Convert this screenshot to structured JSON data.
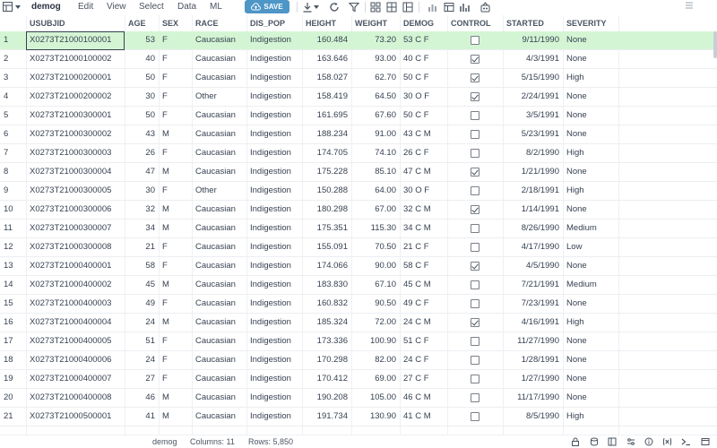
{
  "toolbar": {
    "title": "demog",
    "menus": [
      "Edit",
      "View",
      "Select",
      "Data",
      "ML"
    ],
    "save_label": "SAVE",
    "accent": "#4d96c6"
  },
  "columns": [
    "USUBJID",
    "AGE",
    "SEX",
    "RACE",
    "DIS_POP",
    "HEIGHT",
    "WEIGHT",
    "DEMOG",
    "CONTROL",
    "STARTED",
    "SEVERITY"
  ],
  "rows": [
    {
      "n": "1",
      "id": "X0273T21000100001",
      "age": "53",
      "sex": "F",
      "race": "Caucasian",
      "dis": "Indigestion",
      "height": "160.484",
      "weight": "73.20",
      "demog": "53 C F",
      "control": false,
      "started": "9/11/1990",
      "severity": "None"
    },
    {
      "n": "2",
      "id": "X0273T21000100002",
      "age": "40",
      "sex": "F",
      "race": "Caucasian",
      "dis": "Indigestion",
      "height": "163.646",
      "weight": "93.00",
      "demog": "40 C F",
      "control": true,
      "started": "4/3/1991",
      "severity": "None"
    },
    {
      "n": "3",
      "id": "X0273T21000200001",
      "age": "50",
      "sex": "F",
      "race": "Caucasian",
      "dis": "Indigestion",
      "height": "158.027",
      "weight": "62.70",
      "demog": "50 C F",
      "control": true,
      "started": "5/15/1990",
      "severity": "High"
    },
    {
      "n": "4",
      "id": "X0273T21000200002",
      "age": "30",
      "sex": "F",
      "race": "Other",
      "dis": "Indigestion",
      "height": "158.419",
      "weight": "64.50",
      "demog": "30 O F",
      "control": true,
      "started": "2/24/1991",
      "severity": "None"
    },
    {
      "n": "5",
      "id": "X0273T21000300001",
      "age": "50",
      "sex": "F",
      "race": "Caucasian",
      "dis": "Indigestion",
      "height": "161.695",
      "weight": "67.60",
      "demog": "50 C F",
      "control": false,
      "started": "3/5/1991",
      "severity": "None"
    },
    {
      "n": "6",
      "id": "X0273T21000300002",
      "age": "43",
      "sex": "M",
      "race": "Caucasian",
      "dis": "Indigestion",
      "height": "188.234",
      "weight": "91.00",
      "demog": "43 C M",
      "control": false,
      "started": "5/23/1991",
      "severity": "None"
    },
    {
      "n": "7",
      "id": "X0273T21000300003",
      "age": "26",
      "sex": "F",
      "race": "Caucasian",
      "dis": "Indigestion",
      "height": "174.705",
      "weight": "74.10",
      "demog": "26 C F",
      "control": false,
      "started": "8/2/1990",
      "severity": "High"
    },
    {
      "n": "8",
      "id": "X0273T21000300004",
      "age": "47",
      "sex": "M",
      "race": "Caucasian",
      "dis": "Indigestion",
      "height": "175.228",
      "weight": "85.10",
      "demog": "47 C M",
      "control": true,
      "started": "1/21/1990",
      "severity": "None"
    },
    {
      "n": "9",
      "id": "X0273T21000300005",
      "age": "30",
      "sex": "F",
      "race": "Other",
      "dis": "Indigestion",
      "height": "150.288",
      "weight": "64.00",
      "demog": "30 O F",
      "control": false,
      "started": "2/18/1991",
      "severity": "High"
    },
    {
      "n": "10",
      "id": "X0273T21000300006",
      "age": "32",
      "sex": "M",
      "race": "Caucasian",
      "dis": "Indigestion",
      "height": "180.298",
      "weight": "67.00",
      "demog": "32 C M",
      "control": true,
      "started": "1/14/1991",
      "severity": "None"
    },
    {
      "n": "11",
      "id": "X0273T21000300007",
      "age": "34",
      "sex": "M",
      "race": "Caucasian",
      "dis": "Indigestion",
      "height": "175.351",
      "weight": "115.30",
      "demog": "34 C M",
      "control": false,
      "started": "8/26/1990",
      "severity": "Medium"
    },
    {
      "n": "12",
      "id": "X0273T21000300008",
      "age": "21",
      "sex": "F",
      "race": "Caucasian",
      "dis": "Indigestion",
      "height": "155.091",
      "weight": "70.50",
      "demog": "21 C F",
      "control": false,
      "started": "4/17/1990",
      "severity": "Low"
    },
    {
      "n": "13",
      "id": "X0273T21000400001",
      "age": "58",
      "sex": "F",
      "race": "Caucasian",
      "dis": "Indigestion",
      "height": "174.066",
      "weight": "90.00",
      "demog": "58 C F",
      "control": true,
      "started": "4/5/1990",
      "severity": "None"
    },
    {
      "n": "14",
      "id": "X0273T21000400002",
      "age": "45",
      "sex": "M",
      "race": "Caucasian",
      "dis": "Indigestion",
      "height": "183.830",
      "weight": "67.10",
      "demog": "45 C M",
      "control": false,
      "started": "7/21/1991",
      "severity": "Medium"
    },
    {
      "n": "15",
      "id": "X0273T21000400003",
      "age": "49",
      "sex": "F",
      "race": "Caucasian",
      "dis": "Indigestion",
      "height": "160.832",
      "weight": "90.50",
      "demog": "49 C F",
      "control": false,
      "started": "7/23/1991",
      "severity": "None"
    },
    {
      "n": "16",
      "id": "X0273T21000400004",
      "age": "24",
      "sex": "M",
      "race": "Caucasian",
      "dis": "Indigestion",
      "height": "185.324",
      "weight": "72.00",
      "demog": "24 C M",
      "control": true,
      "started": "4/16/1991",
      "severity": "High"
    },
    {
      "n": "17",
      "id": "X0273T21000400005",
      "age": "51",
      "sex": "F",
      "race": "Caucasian",
      "dis": "Indigestion",
      "height": "173.336",
      "weight": "100.90",
      "demog": "51 C F",
      "control": false,
      "started": "11/27/1990",
      "severity": "None"
    },
    {
      "n": "18",
      "id": "X0273T21000400006",
      "age": "24",
      "sex": "F",
      "race": "Caucasian",
      "dis": "Indigestion",
      "height": "170.298",
      "weight": "82.00",
      "demog": "24 C F",
      "control": false,
      "started": "1/28/1991",
      "severity": "None"
    },
    {
      "n": "19",
      "id": "X0273T21000400007",
      "age": "27",
      "sex": "F",
      "race": "Caucasian",
      "dis": "Indigestion",
      "height": "170.412",
      "weight": "69.00",
      "demog": "27 C F",
      "control": false,
      "started": "1/27/1990",
      "severity": "None"
    },
    {
      "n": "20",
      "id": "X0273T21000400008",
      "age": "46",
      "sex": "M",
      "race": "Caucasian",
      "dis": "Indigestion",
      "height": "190.208",
      "weight": "105.00",
      "demog": "46 C M",
      "control": false,
      "started": "11/17/1990",
      "severity": "None"
    },
    {
      "n": "21",
      "id": "X0273T21000500001",
      "age": "41",
      "sex": "M",
      "race": "Caucasian",
      "dis": "Indigestion",
      "height": "191.734",
      "weight": "130.90",
      "demog": "41 C M",
      "control": false,
      "started": "8/5/1990",
      "severity": "High"
    }
  ],
  "status": {
    "table": "demog",
    "columns": "Columns: 11",
    "rows": "Rows: 5,850"
  },
  "colors": {
    "selected_row": "#d4f5d4"
  }
}
